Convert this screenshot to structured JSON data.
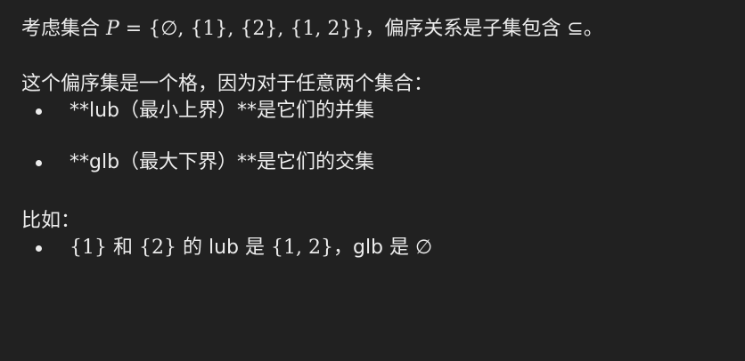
{
  "intro": {
    "text_before": "考虑集合 ",
    "math_var": "P",
    "math_eq": " = {∅, {1}, {2}, {1, 2}}",
    "text_after": "，偏序关系是子集包含 ⊆。"
  },
  "lattice_statement": "这个偏序集是一个格，因为对于任意两个集合：",
  "definitions": [
    {
      "text": "**lub（最小上界）**是它们的并集"
    },
    {
      "text": "**glb（最大下界）**是它们的交集"
    }
  ],
  "example_heading": "比如：",
  "example": {
    "m1": "{1}",
    "t1": " 和 ",
    "m2": "{2}",
    "t2": " 的 lub 是 ",
    "m3": "{1, 2}",
    "t3": "，glb 是 ",
    "m4": "∅"
  }
}
